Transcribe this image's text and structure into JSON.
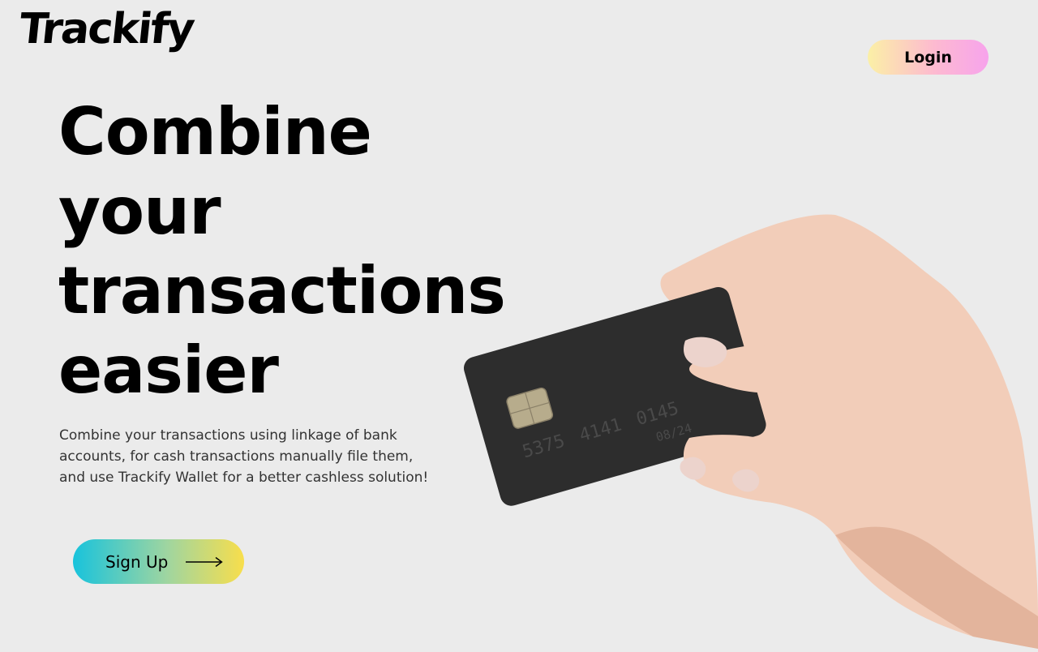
{
  "brand": {
    "name": "Trackify"
  },
  "header": {
    "login_label": "Login"
  },
  "hero": {
    "headline_lines": [
      "Combine",
      "your",
      "transactions",
      "easier"
    ],
    "subtext": "Combine your transactions using linkage of bank accounts, for cash transactions manually file them, and use Trackify Wallet for a better cashless solution!",
    "signup_label": "Sign Up"
  },
  "card": {
    "number_groups": [
      "5375",
      "4141",
      "0145"
    ],
    "expiry": "08/24"
  },
  "icons": {
    "signup_arrow": "long-arrow-right-icon"
  },
  "colors": {
    "background": "#ebebeb",
    "login_gradient": [
      "#fbf0a6",
      "#fdbad0",
      "#f7a3ec"
    ],
    "signup_gradient": [
      "#18c3dc",
      "#9fd5a0",
      "#f8de4c"
    ],
    "card": "#2d2d2d",
    "skin": "#f2cdb9"
  }
}
